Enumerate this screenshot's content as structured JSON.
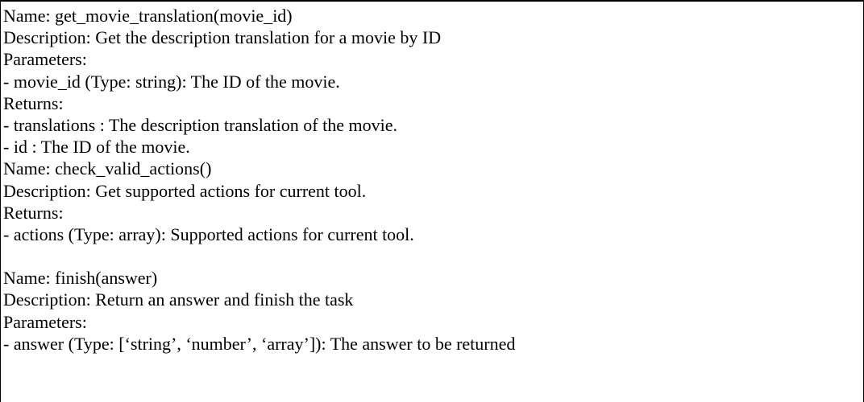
{
  "tools": [
    {
      "name_line": "Name: get_movie_translation(movie_id)",
      "description_line": "Description: Get the description translation for a movie by ID",
      "parameters_heading": "Parameters:",
      "parameters": [
        "- movie_id (Type: string): The ID of the movie."
      ],
      "returns_heading": "Returns:",
      "returns": [
        "- translations : The description translation of the movie.",
        "- id : The ID of the movie."
      ]
    },
    {
      "name_line": "Name: check_valid_actions()",
      "description_line": "Description: Get supported actions for current tool.",
      "returns_heading": "Returns:",
      "returns": [
        "- actions (Type: array): Supported actions for current tool."
      ]
    },
    {
      "name_line": "Name: finish(answer)",
      "description_line": "Description: Return an answer and finish the task",
      "parameters_heading": "Parameters:",
      "parameters": [
        "- answer (Type: [‘string’, ‘number’, ‘array’]): The answer to be returned"
      ]
    }
  ]
}
